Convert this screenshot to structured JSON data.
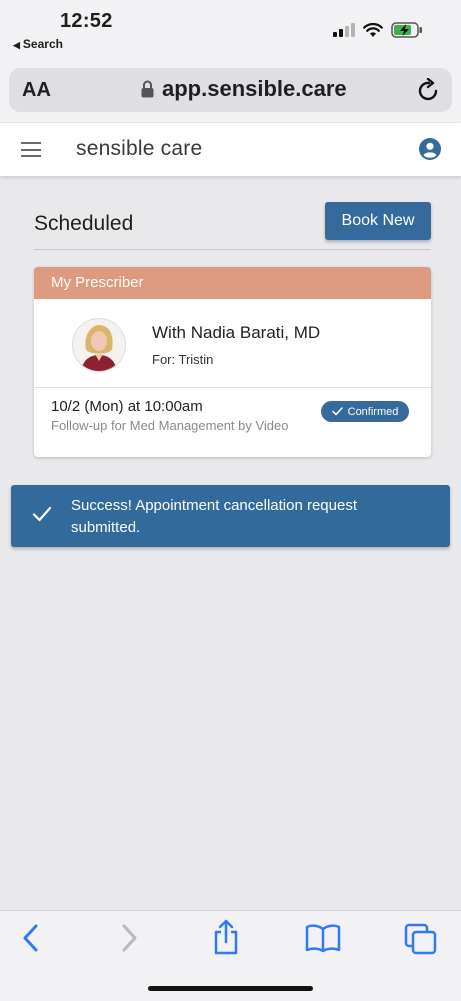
{
  "status_bar": {
    "time": "12:52",
    "back_label": "Search",
    "battery_color": "#3db34a"
  },
  "safari": {
    "text_size_label": "AA",
    "url": "app.sensible.care"
  },
  "app": {
    "brand": "sensible care",
    "section_title": "Scheduled",
    "book_button": "Book New",
    "card": {
      "header": "My Prescriber",
      "header_color": "#de9a7f",
      "provider": "With Nadia Barati, MD",
      "patient": "For: Tristin",
      "datetime": "10/2 (Mon) at 10:00am",
      "description": "Follow-up for Med Management by Video",
      "status": "Confirmed"
    },
    "toast": {
      "message": "Success! Appointment cancellation request submitted.",
      "icon": "checkmark-icon"
    },
    "accent_color": "#346a9c"
  },
  "toolbar": {
    "icons": [
      "back-icon",
      "forward-icon",
      "share-icon",
      "bookmarks-icon",
      "tabs-icon"
    ],
    "icon_color": "#2f7bf6"
  }
}
